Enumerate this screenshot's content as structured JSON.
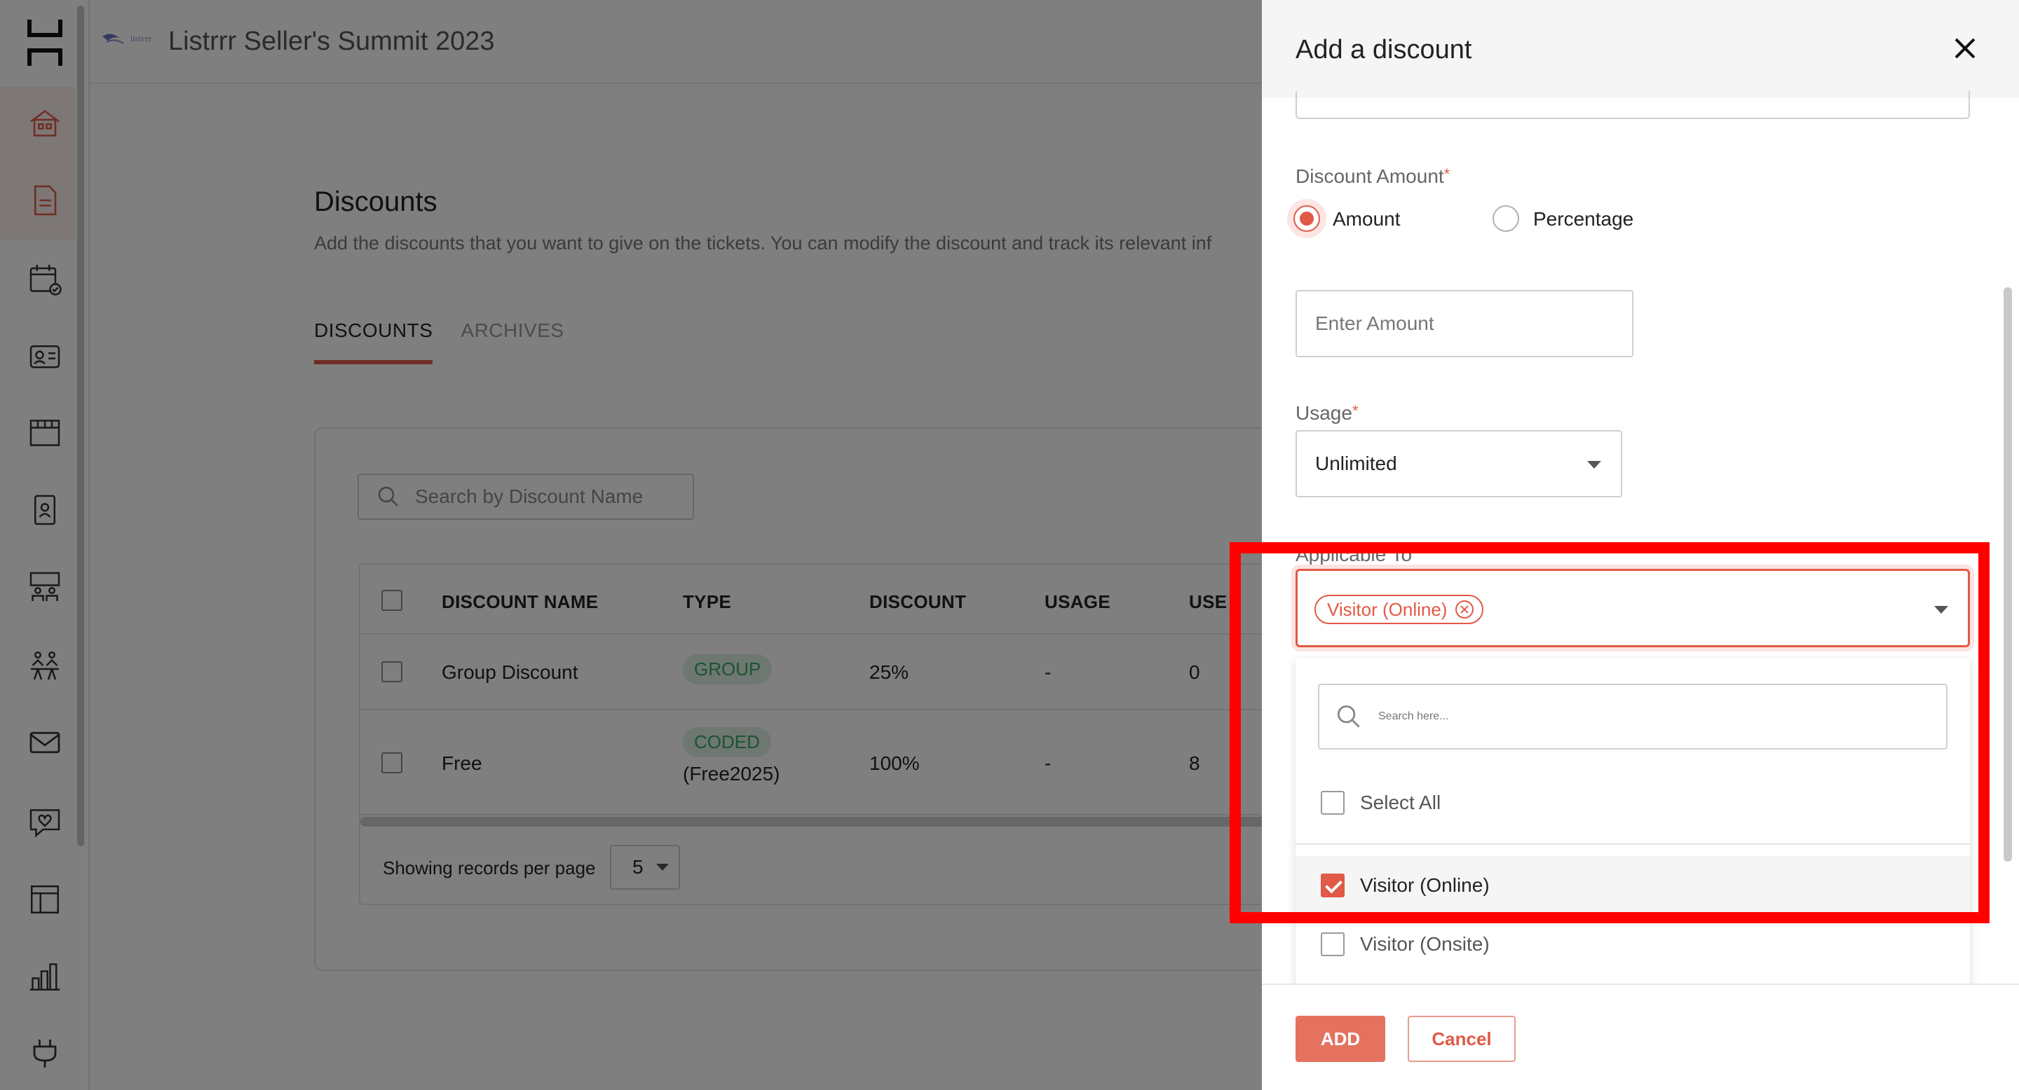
{
  "header": {
    "brand_small": "listrrr",
    "event_title": "Listrrr Seller's Summit 2023"
  },
  "sidebar": {
    "items": [
      {
        "icon": "home-icon"
      },
      {
        "icon": "document-icon"
      },
      {
        "icon": "calendar-check-icon"
      },
      {
        "icon": "id-card-icon"
      },
      {
        "icon": "booth-icon"
      },
      {
        "icon": "badge-icon"
      },
      {
        "icon": "meeting-room-icon"
      },
      {
        "icon": "networking-icon"
      },
      {
        "icon": "mail-icon"
      },
      {
        "icon": "chat-heart-icon"
      },
      {
        "icon": "layout-icon"
      },
      {
        "icon": "bar-chart-icon"
      },
      {
        "icon": "plug-icon"
      }
    ]
  },
  "page": {
    "title": "Discounts",
    "description": "Add the discounts that you want to give on the tickets. You can modify the discount and track its relevant inf",
    "tabs": [
      {
        "label": "DISCOUNTS",
        "active": true
      },
      {
        "label": "ARCHIVES",
        "active": false
      }
    ],
    "search_placeholder": "Search by Discount Name",
    "table": {
      "columns": [
        "DISCOUNT NAME",
        "TYPE",
        "DISCOUNT",
        "USAGE",
        "USE"
      ],
      "rows": [
        {
          "name": "Group Discount",
          "type": "GROUP",
          "code": "",
          "discount": "25%",
          "usage": "-",
          "used": "0"
        },
        {
          "name": "Free",
          "type": "CODED",
          "code": "(Free2025)",
          "discount": "100%",
          "usage": "-",
          "used": "8"
        }
      ]
    },
    "pager": {
      "label": "Showing records per page",
      "value": "5"
    }
  },
  "drawer": {
    "title": "Add a discount",
    "discount_amount": {
      "label": "Discount Amount",
      "required_mark": "*",
      "options": [
        {
          "label": "Amount",
          "selected": true
        },
        {
          "label": "Percentage",
          "selected": false
        }
      ],
      "input_placeholder": "Enter Amount"
    },
    "usage": {
      "label": "Usage",
      "required_mark": "*",
      "value": "Unlimited"
    },
    "applicable_to": {
      "label": "Applicable To",
      "required_mark": "*",
      "chips": [
        "Visitor (Online)"
      ],
      "search_placeholder": "Search here...",
      "select_all_label": "Select All",
      "options": [
        {
          "label": "Visitor (Online)",
          "checked": true
        },
        {
          "label": "Visitor (Onsite)",
          "checked": false
        }
      ]
    },
    "buttons": {
      "add": "ADD",
      "cancel": "Cancel"
    }
  },
  "colors": {
    "accent": "#e05a47",
    "highlight": "#ff0000",
    "pill_bg": "#dcefe2",
    "pill_text": "#3aa867"
  }
}
